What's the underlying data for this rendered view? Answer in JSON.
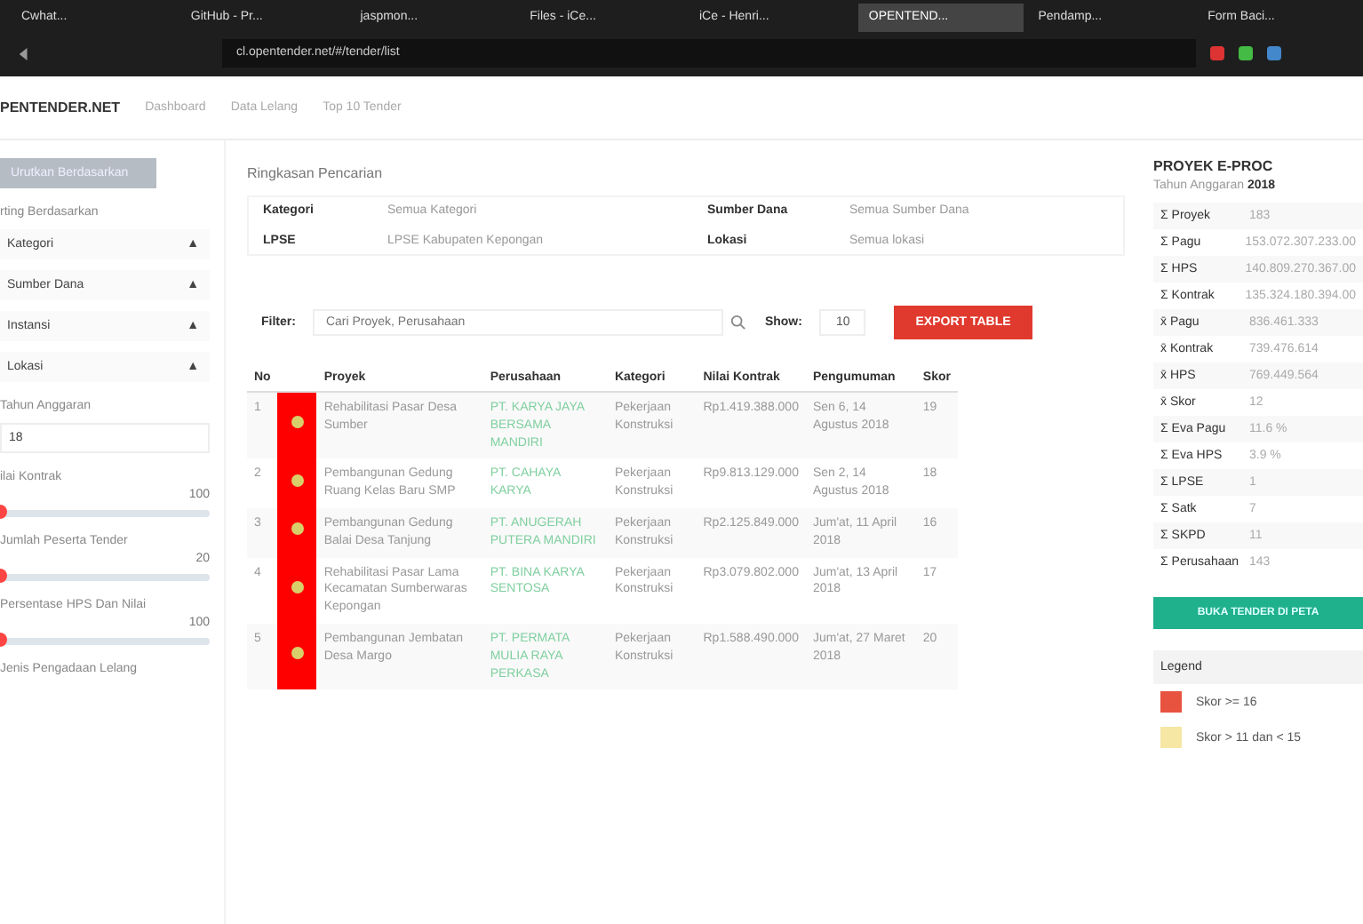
{
  "browser": {
    "tabs": [
      {
        "label": "Cwhat...",
        "selected": false
      },
      {
        "label": "GitHub - Pr...",
        "selected": false
      },
      {
        "label": "jaspmon...",
        "selected": false
      },
      {
        "label": "Files - iCe...",
        "selected": false
      },
      {
        "label": "iCe - Henri...",
        "selected": false
      },
      {
        "label": "OPENTEND...",
        "selected": true
      },
      {
        "label": "Pendamp...",
        "selected": false
      },
      {
        "label": "Form Baci...",
        "selected": false
      }
    ],
    "url": "cl.opentender.net/#/tender/list"
  },
  "navbar": {
    "brand": "PENTENDER.NET",
    "links": [
      "Dashboard",
      "Data Lelang",
      "Top 10 Tender"
    ]
  },
  "sidebar": {
    "button": "Urutkan Berdasarkan",
    "sort_title": "rting Berdasarkan",
    "sort_items": [
      {
        "label": "Kategori",
        "icon": "▲"
      },
      {
        "label": "Sumber Dana",
        "icon": "▲"
      },
      {
        "label": "Instansi",
        "icon": "▲"
      },
      {
        "label": "Lokasi",
        "icon": "▲"
      }
    ],
    "year_title": "Tahun Anggaran",
    "year_value": "18",
    "sliders": [
      {
        "title": "ilai Kontrak",
        "reading": "100",
        "level": 0
      },
      {
        "title": "Jumlah Peserta Tender",
        "reading": "20",
        "level": 0
      },
      {
        "title": "Persentase HPS Dan Nilai",
        "reading": "100",
        "level": 0
      }
    ],
    "last_title": "Jenis Pengadaan Lelang"
  },
  "summary": {
    "title": "Ringkasan Pencarian",
    "fields": [
      {
        "label": "Kategori",
        "value": "Semua Kategori"
      },
      {
        "label": "Sumber Dana",
        "value": "Semua Sumber Dana"
      },
      {
        "label": "LPSE",
        "value": "LPSE Kabupaten Kepongan"
      },
      {
        "label": "Lokasi",
        "value": "Semua lokasi"
      }
    ]
  },
  "filter": {
    "label": "Filter:",
    "placeholder": "Cari Proyek, Perusahaan",
    "show_label": "Show:",
    "show_value": "10",
    "export": "EXPORT TABLE"
  },
  "table": {
    "columns": [
      "No",
      "Proyek",
      "Perusahaan",
      "Kategori",
      "Nilai Kontrak",
      "Pengumuman",
      "Skor"
    ],
    "rows": [
      {
        "no": "1",
        "color": "#ff0000",
        "proyek": "Rehabilitasi Pasar Desa Sumber",
        "perusahaan": "PT. KARYA JAYA BERSAMA MANDIRI",
        "kategori": "Pekerjaan Konstruksi",
        "nilai": "Rp1.419.388.000",
        "pengumuman": "Sen 6, 14 Agustus 2018",
        "skor": "19"
      },
      {
        "no": "2",
        "color": "#ff0000",
        "proyek": "Pembangunan Gedung Ruang Kelas Baru SMP",
        "perusahaan": "PT. CAHAYA KARYA",
        "kategori": "Pekerjaan Konstruksi",
        "nilai": "Rp9.813.129.000",
        "pengumuman": "Sen 2, 14 Agustus 2018",
        "skor": "18"
      },
      {
        "no": "3",
        "color": "#ff0000",
        "proyek": "Pembangunan Gedung Balai Desa Tanjung",
        "perusahaan": "PT. ANUGERAH PUTERA MANDIRI",
        "kategori": "Pekerjaan Konstruksi",
        "nilai": "Rp2.125.849.000",
        "pengumuman": "Jum'at, 11 April 2018",
        "skor": "16"
      },
      {
        "no": "4",
        "color": "#ff0000",
        "proyek": "Rehabilitasi Pasar Lama Kecamatan Sumberwaras Kepongan",
        "perusahaan": "PT. BINA KARYA SENTOSA",
        "kategori": "Pekerjaan Konstruksi",
        "nilai": "Rp3.079.802.000",
        "pengumuman": "Jum'at, 13 April 2018",
        "skor": "17"
      },
      {
        "no": "5",
        "color": "#ff0000",
        "proyek": "Pembangunan Jembatan Desa Margo",
        "perusahaan": "PT. PERMATA MULIA RAYA PERKASA",
        "kategori": "Pekerjaan Konstruksi",
        "nilai": "Rp1.588.490.000",
        "pengumuman": "Jum'at, 27 Maret 2018",
        "skor": "20"
      }
    ]
  },
  "stats": {
    "title": "PROYEK E-PROC",
    "subtitle": "Tahun Anggaran",
    "year": "2018",
    "rows": [
      {
        "label": "Σ Proyek",
        "value": "183"
      },
      {
        "label": "Σ Pagu",
        "value": "153.072.307.233.00"
      },
      {
        "label": "Σ HPS",
        "value": "140.809.270.367.00"
      },
      {
        "label": "Σ Kontrak",
        "value": "135.324.180.394.00"
      },
      {
        "label": "x̄ Pagu",
        "value": "836.461.333"
      },
      {
        "label": "x̄ Kontrak",
        "value": "739.476.614"
      },
      {
        "label": "x̄ HPS",
        "value": "769.449.564"
      },
      {
        "label": "x̄ Skor",
        "value": "12"
      },
      {
        "label": "Σ Eva Pagu",
        "value": "11.6 %"
      },
      {
        "label": "Σ Eva HPS",
        "value": "3.9 %"
      },
      {
        "label": "Σ LPSE",
        "value": "1"
      },
      {
        "label": "Σ Satk",
        "value": "7"
      },
      {
        "label": "Σ SKPD",
        "value": "11"
      },
      {
        "label": "Σ Perusahaan",
        "value": "143"
      }
    ],
    "map_button": "BUKA TENDER DI PETA",
    "legend_title": "Legend",
    "legend": [
      {
        "label": "Skor >= 16",
        "color": "#e8533f"
      },
      {
        "label": "Skor > 11 dan < 15",
        "color": "#f7e7a5"
      }
    ]
  }
}
